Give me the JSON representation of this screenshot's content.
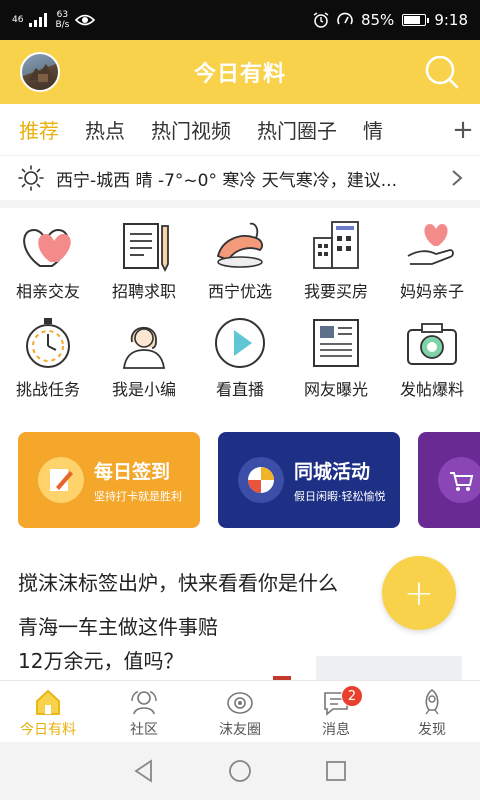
{
  "status_bar": {
    "network": "46",
    "speed_value": "63",
    "speed_unit": "B/s",
    "battery": "85%",
    "battery_level": 0.85,
    "time": "9:18"
  },
  "header": {
    "title": "今日有料"
  },
  "tabs": [
    {
      "label": "推荐",
      "active": true
    },
    {
      "label": "热点"
    },
    {
      "label": "热门视频"
    },
    {
      "label": "热门圈子"
    },
    {
      "label": "情"
    }
  ],
  "tabs_more": "+",
  "weather": {
    "text": "西宁-城西 晴 -7°~0° 寒冷 天气寒冷，建议..."
  },
  "grid": [
    {
      "label": "相亲交友",
      "icon": "hearts-icon"
    },
    {
      "label": "招聘求职",
      "icon": "resume-icon"
    },
    {
      "label": "西宁优选",
      "icon": "shrimp-icon"
    },
    {
      "label": "我要买房",
      "icon": "building-icon"
    },
    {
      "label": "妈妈亲子",
      "icon": "heart-hand-icon"
    },
    {
      "label": "挑战任务",
      "icon": "stopwatch-icon"
    },
    {
      "label": "我是小编",
      "icon": "editor-person-icon"
    },
    {
      "label": "看直播",
      "icon": "play-icon"
    },
    {
      "label": "网友曝光",
      "icon": "newspaper-icon"
    },
    {
      "label": "发帖爆料",
      "icon": "camera-icon"
    }
  ],
  "banners": [
    {
      "title": "每日签到",
      "subtitle": "坚持打卡就是胜利",
      "color": "#f4a72b"
    },
    {
      "title": "同城活动",
      "subtitle": "假日闲暇·轻松愉悦",
      "color": "#1e2f86"
    },
    {
      "color": "#6a2a93"
    }
  ],
  "article": {
    "line1": "搅沫沫标签出炉，快来看看你是什么",
    "line2": "青海一车主做这件事赔",
    "line3": "12万余元，值吗？"
  },
  "fab": "+",
  "bottom_nav": [
    {
      "label": "今日有料",
      "active": true
    },
    {
      "label": "社区"
    },
    {
      "label": "沫友圈"
    },
    {
      "label": "消息",
      "badge": "2"
    },
    {
      "label": "发现"
    }
  ],
  "colors": {
    "brand_yellow": "#f8d24a",
    "active_tab": "#e8b10d",
    "badge_red": "#e8402c"
  }
}
